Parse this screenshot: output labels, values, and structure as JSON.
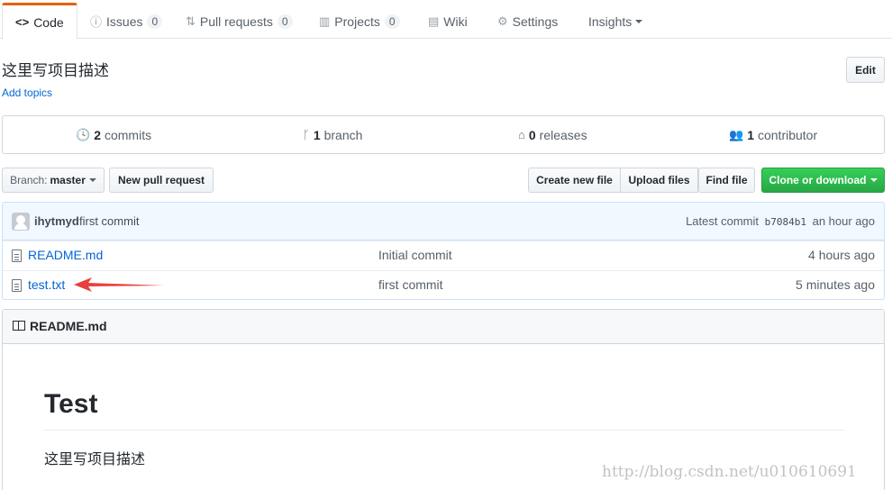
{
  "tabs": [
    {
      "label": "Code",
      "icon": "code-icon"
    },
    {
      "label": "Issues",
      "icon": "issue-opened-icon",
      "count": "0"
    },
    {
      "label": "Pull requests",
      "icon": "git-pull-request-icon",
      "count": "0"
    },
    {
      "label": "Projects",
      "icon": "project-icon",
      "count": "0"
    },
    {
      "label": "Wiki",
      "icon": "book-icon"
    },
    {
      "label": "Settings",
      "icon": "gear-icon"
    },
    {
      "label": "Insights",
      "icon": "chevron-down-icon"
    }
  ],
  "repo": {
    "description": "这里写项目描述",
    "add_topics": "Add topics",
    "edit_label": "Edit"
  },
  "summary": {
    "commits_count": "2",
    "commits_label": "commits",
    "branch_count": "1",
    "branch_label": "branch",
    "releases_count": "0",
    "releases_label": "releases",
    "contributors_count": "1",
    "contributors_label": "contributor"
  },
  "file_nav": {
    "branch_prefix": "Branch:",
    "branch_name": "master",
    "new_pull_request": "New pull request",
    "create_new_file": "Create new file",
    "upload_files": "Upload files",
    "find_file": "Find file",
    "clone_or_download": "Clone or download"
  },
  "latest_commit": {
    "author": "ihytmyd",
    "message": "first commit",
    "prefix": "Latest commit",
    "sha": "b7084b1",
    "age": "an hour ago"
  },
  "files": [
    {
      "name": "README.md",
      "message": "Initial commit",
      "age": "4 hours ago"
    },
    {
      "name": "test.txt",
      "message": "first commit",
      "age": "5 minutes ago"
    }
  ],
  "readme": {
    "header": "README.md",
    "h1": "Test",
    "paragraph": "这里写项目描述"
  },
  "watermark": "http://blog.csdn.net/u010610691",
  "colors": {
    "accent": "#e36209",
    "link": "#0366d6",
    "clone_button": "#28a745",
    "annotation_arrow": "#e8403a"
  }
}
